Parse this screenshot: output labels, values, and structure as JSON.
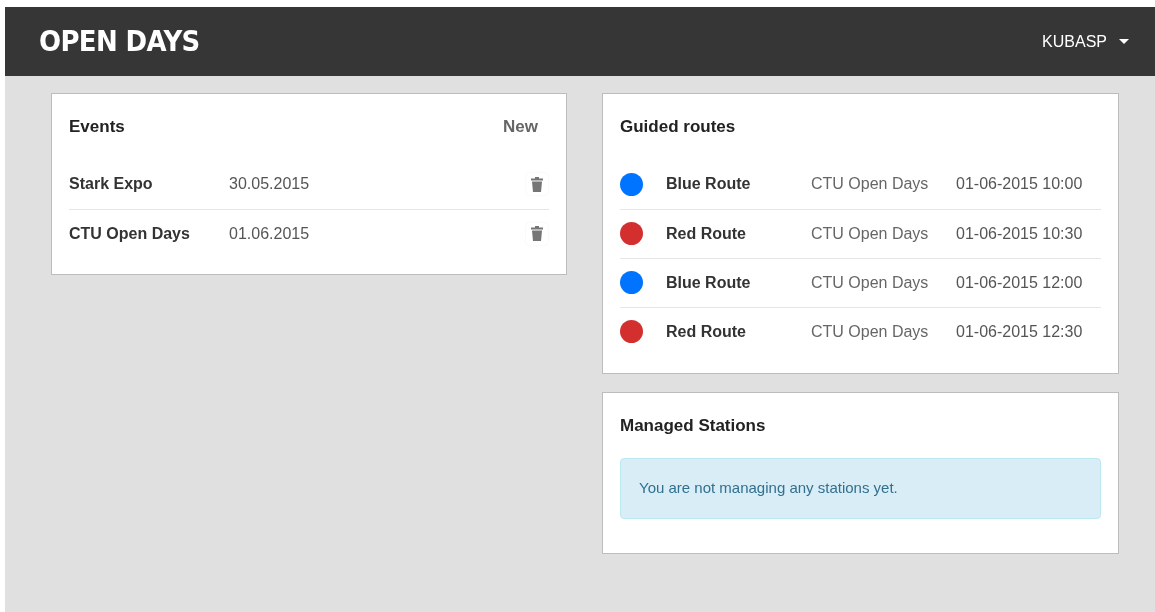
{
  "navbar": {
    "brand": "OPEN DAYS",
    "user": "KUBASP"
  },
  "events": {
    "title": "Events",
    "new_label": "New",
    "rows": [
      {
        "name": "Stark Expo",
        "date": "30.05.2015"
      },
      {
        "name": "CTU Open Days",
        "date": "01.06.2015"
      }
    ]
  },
  "guided_routes": {
    "title": "Guided routes",
    "rows": [
      {
        "name": "Blue Route",
        "color": "#0073ff",
        "event": "CTU Open Days",
        "time": "01-06-2015 10:00"
      },
      {
        "name": "Red Route",
        "color": "#d32f2f",
        "event": "CTU Open Days",
        "time": "01-06-2015 10:30"
      },
      {
        "name": "Blue Route",
        "color": "#0073ff",
        "event": "CTU Open Days",
        "time": "01-06-2015 12:00"
      },
      {
        "name": "Red Route",
        "color": "#d32f2f",
        "event": "CTU Open Days",
        "time": "01-06-2015 12:30"
      }
    ]
  },
  "managed_stations": {
    "title": "Managed Stations",
    "message": "You are not managing any stations yet."
  }
}
